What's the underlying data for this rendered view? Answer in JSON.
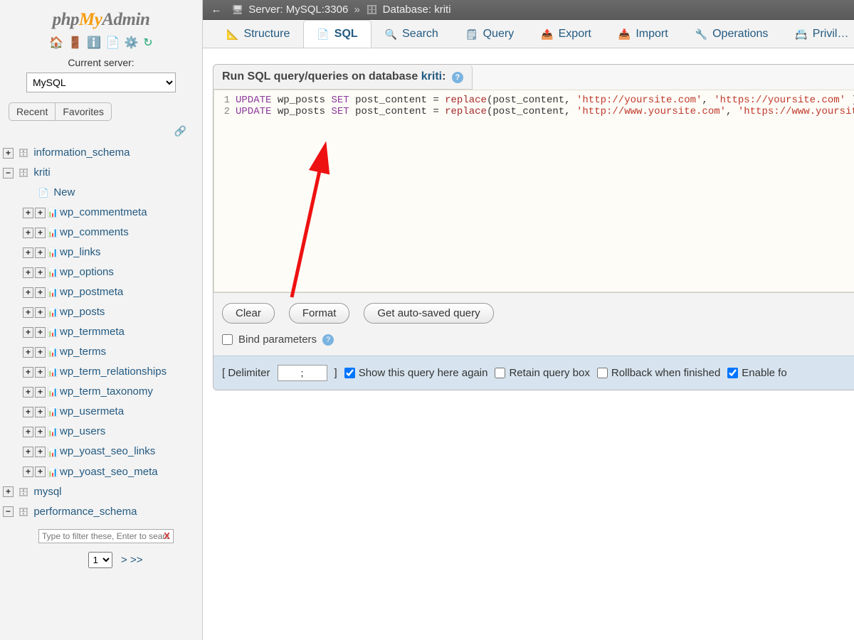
{
  "logo": {
    "p1": "php",
    "p2": "My",
    "p3": "Admin"
  },
  "sidebar": {
    "current_server_label": "Current server:",
    "current_server_value": "MySQL",
    "recent_label": "Recent",
    "favorites_label": "Favorites",
    "link_glyph": "🔗",
    "databases": [
      {
        "name": "information_schema",
        "expanded": false
      },
      {
        "name": "kriti",
        "expanded": true,
        "new_label": "New",
        "tables": [
          "wp_commentmeta",
          "wp_comments",
          "wp_links",
          "wp_options",
          "wp_postmeta",
          "wp_posts",
          "wp_termmeta",
          "wp_terms",
          "wp_term_relationships",
          "wp_term_taxonomy",
          "wp_usermeta",
          "wp_users",
          "wp_yoast_seo_links",
          "wp_yoast_seo_meta"
        ]
      },
      {
        "name": "mysql",
        "expanded": false
      },
      {
        "name": "performance_schema",
        "expanded": true,
        "tables": []
      }
    ],
    "filter_placeholder": "Type to filter these, Enter to search",
    "pager_value": "1",
    "pager_next": "> >>"
  },
  "breadcrumb": {
    "back": "←",
    "server_label": "Server:",
    "server_value": "MySQL:3306",
    "sep": "»",
    "db_label": "Database:",
    "db_value": "kriti"
  },
  "tabs": [
    {
      "icon": "📐",
      "label": "Structure"
    },
    {
      "icon": "📄",
      "label": "SQL",
      "active": true
    },
    {
      "icon": "🔍",
      "label": "Search"
    },
    {
      "icon": "🗒",
      "label": "Query"
    },
    {
      "icon": "📤",
      "label": "Export"
    },
    {
      "icon": "📥",
      "label": "Import"
    },
    {
      "icon": "🔧",
      "label": "Operations"
    },
    {
      "icon": "📇",
      "label": "Privil…"
    }
  ],
  "sql": {
    "heading_pre": "Run SQL query/queries on database ",
    "heading_db": "kriti",
    "heading_post": ":",
    "lines": [
      {
        "n": 1,
        "kw1": "UPDATE",
        "tbl": "wp_posts",
        "kw2": "SET",
        "col": "post_content",
        "fn": "replace",
        "arg1": "post_content",
        "s1": "'http://yoursite.com'",
        "s2": "'https://yoursite.com'"
      },
      {
        "n": 2,
        "kw1": "UPDATE",
        "tbl": "wp_posts",
        "kw2": "SET",
        "col": "post_content",
        "fn": "replace",
        "arg1": "post_content",
        "s1": "'http://www.yoursite.com'",
        "s2": "'https://www.yoursite.com'"
      }
    ],
    "buttons": {
      "clear": "Clear",
      "format": "Format",
      "autosaved": "Get auto-saved query"
    },
    "bind_params_label": "Bind parameters",
    "delimiter_label_pre": "[ Delimiter",
    "delimiter_value": ";",
    "delimiter_label_post": "]",
    "show_again": "Show this query here again",
    "retain": "Retain query box",
    "rollback": "Rollback when finished",
    "enable_fk": "Enable fo"
  }
}
